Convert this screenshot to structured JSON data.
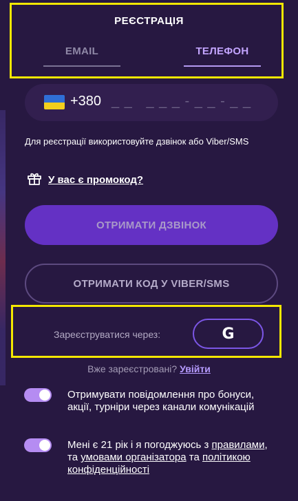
{
  "header": {
    "title": "РЕЄСТРАЦІЯ"
  },
  "tabs": [
    {
      "label": "EMAIL",
      "active": false
    },
    {
      "label": "ТЕЛЕФОН",
      "active": true
    }
  ],
  "phone": {
    "country_code": "+380",
    "mask": "_ _   _ _ _ - _ _ - _ _"
  },
  "hint": "Для реєстрації використовуйте дзвінок або Viber/SMS",
  "promo": {
    "label": "У вас є промокод?"
  },
  "buttons": {
    "call": "ОТРИМАТИ ДЗВІНОК",
    "sms": "ОТРИМАТИ КОД У VIBER/SMS"
  },
  "social": {
    "label": "Зареєструватися через:",
    "google_glyph": "G"
  },
  "login": {
    "prompt": "Вже зареєстровані?",
    "link": "Увійти"
  },
  "consents": {
    "notifications": {
      "text": "Отримувати повідомлення про бонуси, акції, турніри через канали комунікацій",
      "checked": true
    },
    "age": {
      "text_before": "Мені є 21 рік і я погоджуюсь з ",
      "rules_link": "правилами",
      "text_mid1": ", та ",
      "terms_link": "умовами організатора",
      "text_mid2": " та ",
      "privacy_link": "політикою конфіденційності",
      "checked": true
    }
  },
  "colors": {
    "accent": "#6431c4",
    "highlight": "#f4e800",
    "toggle": "#b58cf2"
  },
  "icons": {
    "flag": "ukraine-flag-icon",
    "promo": "gift-icon",
    "google": "google-icon"
  }
}
